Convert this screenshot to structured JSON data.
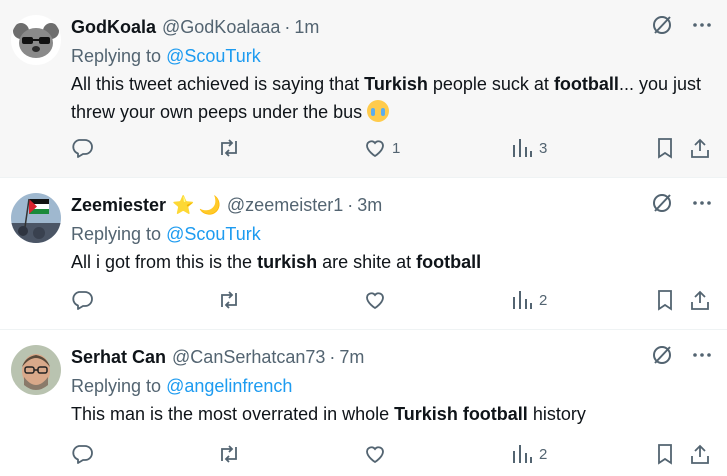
{
  "tweets": [
    {
      "name": "GodKoala",
      "handle": "@GodKoalaaa",
      "dot": "·",
      "time": "1m",
      "reply_prefix": "Replying to ",
      "reply_to": "@ScouTurk",
      "text": [
        {
          "t": "All this tweet achieved is saying that ",
          "b": false
        },
        {
          "t": "Turkish",
          "b": true
        },
        {
          "t": " people suck at ",
          "b": false
        },
        {
          "t": "football",
          "b": true
        },
        {
          "t": "... you just threw your own peeps under the bus ",
          "b": false
        }
      ],
      "emoji": "loudly-crying-face",
      "likes": "1",
      "views": "3"
    },
    {
      "name": "Zeemiester",
      "badges": [
        "⭐",
        "🌙"
      ],
      "handle": "@zeemeister1",
      "dot": "·",
      "time": "3m",
      "reply_prefix": "Replying to ",
      "reply_to": "@ScouTurk",
      "text": [
        {
          "t": "All i got from this is the ",
          "b": false
        },
        {
          "t": "turkish",
          "b": true
        },
        {
          "t": " are shite at ",
          "b": false
        },
        {
          "t": "football",
          "b": true
        }
      ],
      "likes": "",
      "views": "2"
    },
    {
      "name": "Serhat Can",
      "handle": "@CanSerhatcan73",
      "dot": "·",
      "time": "7m",
      "reply_prefix": "Replying to ",
      "reply_to": "@angelinfrench",
      "text": [
        {
          "t": "This man is the most overrated in whole ",
          "b": false
        },
        {
          "t": "Turkish football",
          "b": true
        },
        {
          "t": " history",
          "b": false
        }
      ],
      "likes": "",
      "views": "2"
    }
  ],
  "colors": {
    "link": "#1d9bf0",
    "secondary_text": "#536471",
    "primary_text": "#0f1419",
    "highlight_bg": "#f7f7f7"
  }
}
